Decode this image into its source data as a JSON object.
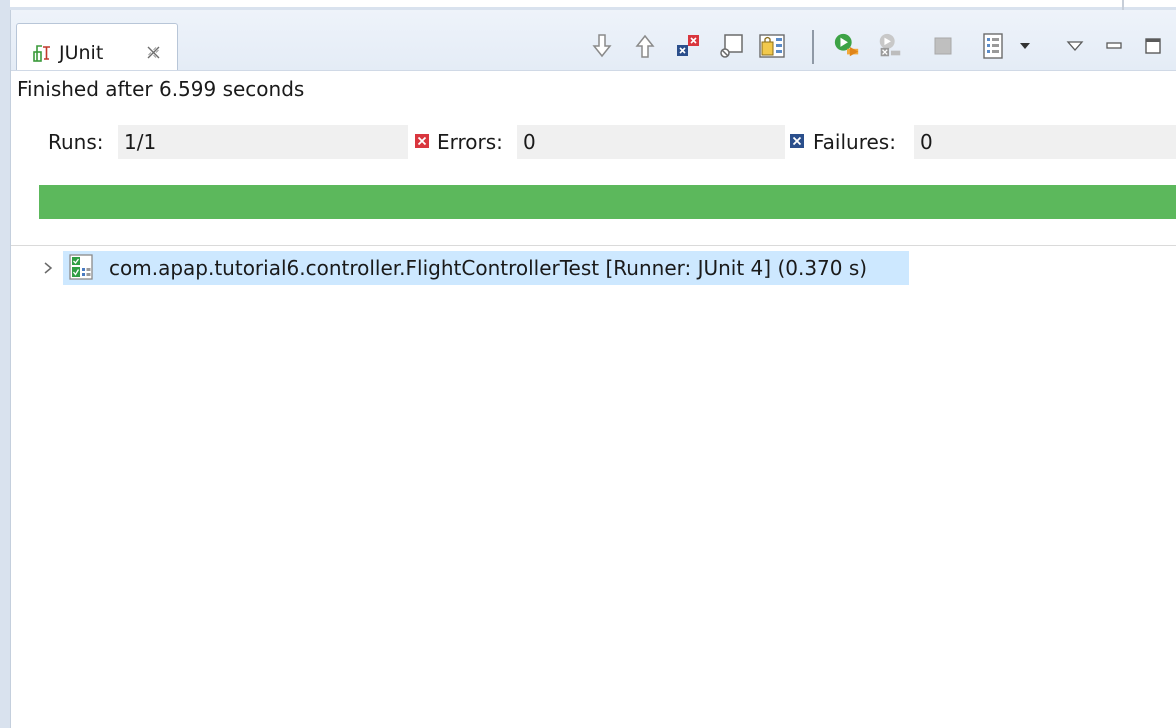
{
  "view": {
    "tab_label": "JUnit",
    "tab_close_icon": "close-icon",
    "toolbar_icons": [
      "next-failure-icon",
      "previous-failure-icon",
      "show-failures-only-icon",
      "scroll-lock-icon",
      "test-history-icon",
      "rerun-test-icon",
      "rerun-failed-first-icon",
      "stop-icon",
      "layout-menu-icon",
      "dropdown-icon",
      "view-menu-icon",
      "minimize-icon",
      "maximize-icon"
    ]
  },
  "status": {
    "message": "Finished after 6.599 seconds"
  },
  "counters": {
    "runs_label": "Runs:",
    "runs_value": "1/1",
    "errors_label": "Errors:",
    "errors_value": "0",
    "failures_label": "Failures:",
    "failures_value": "0"
  },
  "progress": {
    "fraction": 1.0,
    "color": "#5cb85c"
  },
  "tree": {
    "items": [
      {
        "label": "com.apap.tutorial6.controller.FlightControllerTest [Runner: JUnit 4] (0.370 s)",
        "icon": "test-suite-passed-icon",
        "expanded": false
      }
    ]
  },
  "colors": {
    "selection": "#cde8ff",
    "error_red": "#d9363e",
    "failure_blue": "#2b4f8c"
  }
}
